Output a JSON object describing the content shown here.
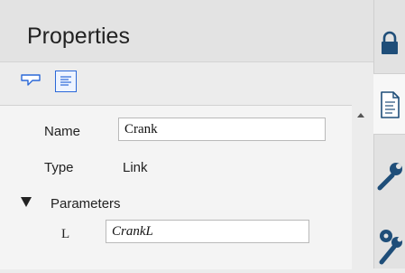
{
  "panel": {
    "title": "Properties"
  },
  "toolbar": {
    "items": [
      {
        "icon": "comment-icon"
      },
      {
        "icon": "details-icon",
        "selected": true
      }
    ]
  },
  "properties": {
    "name_label": "Name",
    "name_value": "Crank",
    "type_label": "Type",
    "type_value": "Link",
    "parameters_label": "Parameters",
    "parameters": [
      {
        "label": "L",
        "value": "CrankL"
      }
    ]
  },
  "side_tabs": [
    {
      "icon": "lock-icon"
    },
    {
      "icon": "document-icon",
      "active": true
    },
    {
      "icon": "wrench-icon"
    },
    {
      "icon": "gear-wrench-icon"
    }
  ],
  "colors": {
    "accent": "#2b68d8",
    "icon": "#1f4e79"
  }
}
